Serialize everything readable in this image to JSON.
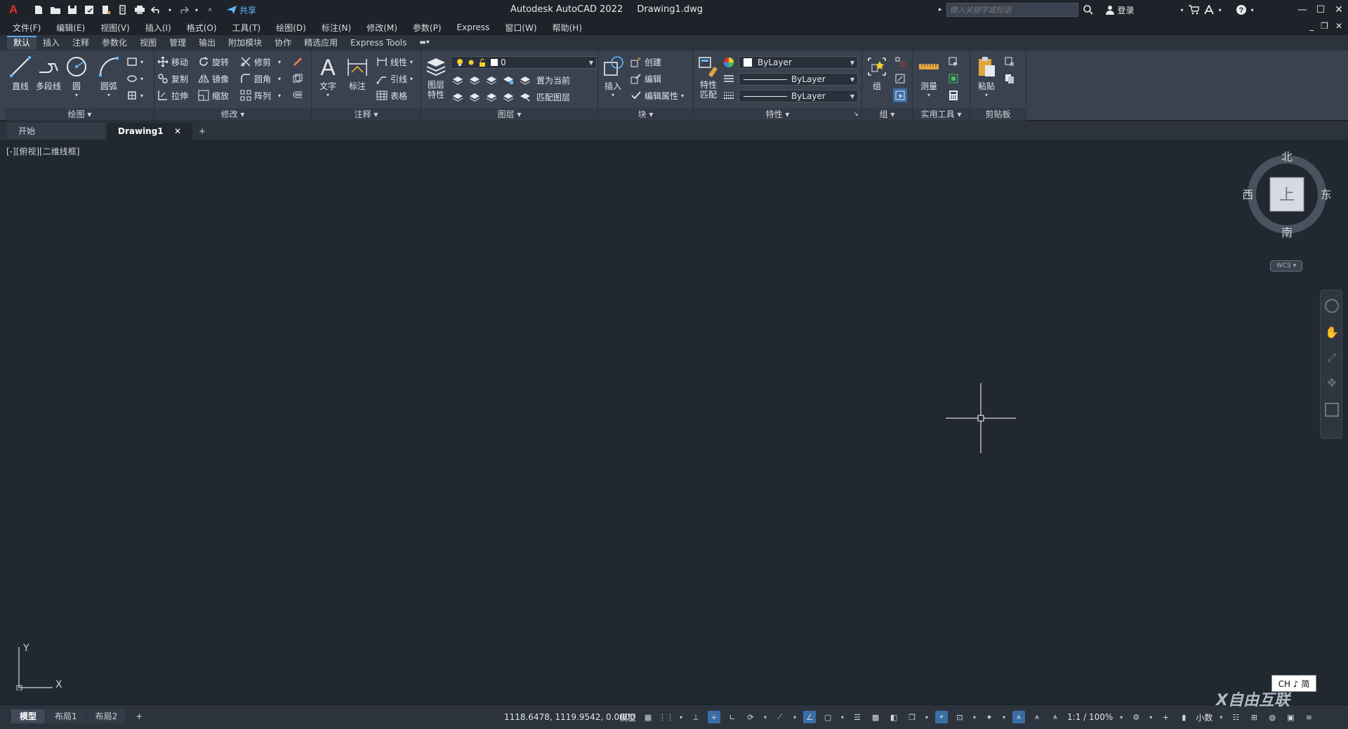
{
  "titlebar": {
    "app_logo": "A",
    "share_label": "共享",
    "app_name": "Autodesk AutoCAD 2022",
    "doc_name": "Drawing1.dwg",
    "search_placeholder": "键入关键字或短语",
    "login_label": "登录"
  },
  "menubar": {
    "items": [
      "文件(F)",
      "编辑(E)",
      "视图(V)",
      "插入(I)",
      "格式(O)",
      "工具(T)",
      "绘图(D)",
      "标注(N)",
      "修改(M)",
      "参数(P)",
      "Express",
      "窗口(W)",
      "帮助(H)"
    ]
  },
  "ribbon_tabs": [
    "默认",
    "插入",
    "注释",
    "参数化",
    "视图",
    "管理",
    "输出",
    "附加模块",
    "协作",
    "精选应用",
    "Express Tools"
  ],
  "ribbon": {
    "draw": {
      "title": "绘图",
      "line": "直线",
      "polyline": "多段线",
      "circle": "圆",
      "arc": "圆弧"
    },
    "modify": {
      "title": "修改",
      "move": "移动",
      "rotate": "旋转",
      "trim": "修剪",
      "copy": "复制",
      "mirror": "镜像",
      "fillet": "圆角",
      "stretch": "拉伸",
      "scale": "缩放",
      "array": "阵列"
    },
    "annotation": {
      "title": "注释",
      "text": "文字",
      "dimension": "标注",
      "linear": "线性",
      "leader": "引线",
      "table": "表格"
    },
    "layers": {
      "title": "图层",
      "layer_props_1": "图层",
      "layer_props_2": "特性",
      "current_layer": "0",
      "set_current": "置为当前",
      "match_layer": "匹配图层"
    },
    "block": {
      "title": "块",
      "insert": "插入",
      "create": "创建",
      "edit": "编辑",
      "edit_attr": "编辑属性"
    },
    "properties": {
      "title": "特性",
      "match_1": "特性",
      "match_2": "匹配",
      "color": "ByLayer",
      "linetype": "ByLayer",
      "lineweight": "ByLayer"
    },
    "groups": {
      "title": "组",
      "group": "组"
    },
    "utilities": {
      "title": "实用工具",
      "measure": "测量"
    },
    "clipboard": {
      "title": "剪贴板",
      "paste": "粘贴"
    }
  },
  "file_tabs": {
    "start": "开始",
    "drawing": "Drawing1"
  },
  "canvas": {
    "viewport_label": "[-][俯视][二维线框]",
    "compass": {
      "north": "北",
      "south": "南",
      "east": "东",
      "west": "西",
      "top": "上"
    },
    "wcs_label": "WCS",
    "ucs_x": "X",
    "ucs_y": "Y"
  },
  "layout_tabs": [
    "模型",
    "布局1",
    "布局2"
  ],
  "statusbar": {
    "coords": "1118.6478, 1119.9542, 0.0000",
    "model": "模型",
    "scale": "1:1 / 100%",
    "units": "小数"
  },
  "ime": {
    "label": "CH ♪ 简"
  },
  "watermark": {
    "text": "X自由互联"
  },
  "colors": {
    "canvas_bg": "#212830",
    "ribbon_bg": "#3a4250",
    "accent": "#5aa4e6",
    "logo_red": "#e0312a"
  }
}
